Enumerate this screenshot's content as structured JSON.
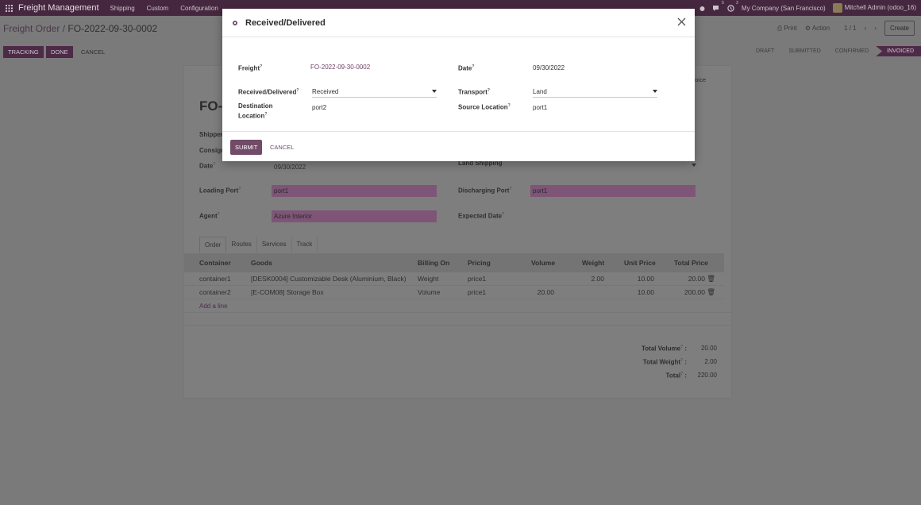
{
  "navbar": {
    "brand": "Freight Management",
    "menus": [
      "Shipping",
      "Custom",
      "Configuration"
    ],
    "messages_badge": "5",
    "activity_badge": "2",
    "company": "My Company (San Francisco)",
    "user": "Mitchell Admin (odoo_16)"
  },
  "control": {
    "breadcrumb_parent": "Freight Order",
    "breadcrumb_sep": "/",
    "breadcrumb_current": "FO-2022-09-30-0002",
    "print": "Print",
    "action": "Action",
    "pager": "1 / 1",
    "create": "Create",
    "buttons": [
      "TRACKING",
      "DONE",
      "CANCEL"
    ],
    "stages": [
      "DRAFT",
      "SUBMITTED",
      "CONFIRMED",
      "INVOICED"
    ],
    "active_stage": "INVOICED"
  },
  "sheet": {
    "smart_button": "oice",
    "title": "FO-",
    "labels": {
      "shipper": "Shipper",
      "consignee": "Consign",
      "date": "Date",
      "loading_port": "Loading Port",
      "agent": "Agent",
      "land_shipping": "Land Shipping",
      "discharging_port": "Discharging Port",
      "expected_date": "Expected Date"
    },
    "values": {
      "date": "09/30/2022",
      "loading_port": "port1",
      "agent": "Azure Interior",
      "discharging_port": "port1"
    },
    "tabs": [
      "Order",
      "Routes",
      "Services",
      "Track"
    ],
    "table": {
      "headers": [
        "Container",
        "Goods",
        "Billing On",
        "Pricing",
        "Volume",
        "Weight",
        "Unit Price",
        "Total Price"
      ],
      "rows": [
        [
          "container1",
          "[DESK0004] Customizable Desk (Aluminium, Black)",
          "Weight",
          "price1",
          "",
          "2.00",
          "10.00",
          "20.00"
        ],
        [
          "container2",
          "[E-COM08] Storage Box",
          "Volume",
          "price1",
          "20.00",
          "",
          "10.00",
          "200.00"
        ]
      ],
      "add_line": "Add a line"
    },
    "totals": [
      {
        "label": "Total Volume",
        "value": "20.00"
      },
      {
        "label": "Total Weight",
        "value": "2.00"
      },
      {
        "label": "Total",
        "value": "220.00"
      }
    ]
  },
  "modal": {
    "title": "Received/Delivered",
    "fields": {
      "freight_label": "Freight",
      "freight_value": "FO-2022-09-30-0002",
      "date_label": "Date",
      "date_value": "09/30/2022",
      "received_label": "Received/Delivered",
      "received_value": "Received",
      "transport_label": "Transport",
      "transport_value": "Land",
      "destination_label_1": "Destination",
      "destination_label_2": "Location",
      "destination_value": "port2",
      "source_label": "Source Location",
      "source_value": "port1"
    },
    "submit": "SUBMIT",
    "cancel": "CANCEL"
  },
  "colors": {
    "navbar": "#45283f",
    "primary": "#714b67",
    "overlay_bg": "#7a7a7a"
  }
}
